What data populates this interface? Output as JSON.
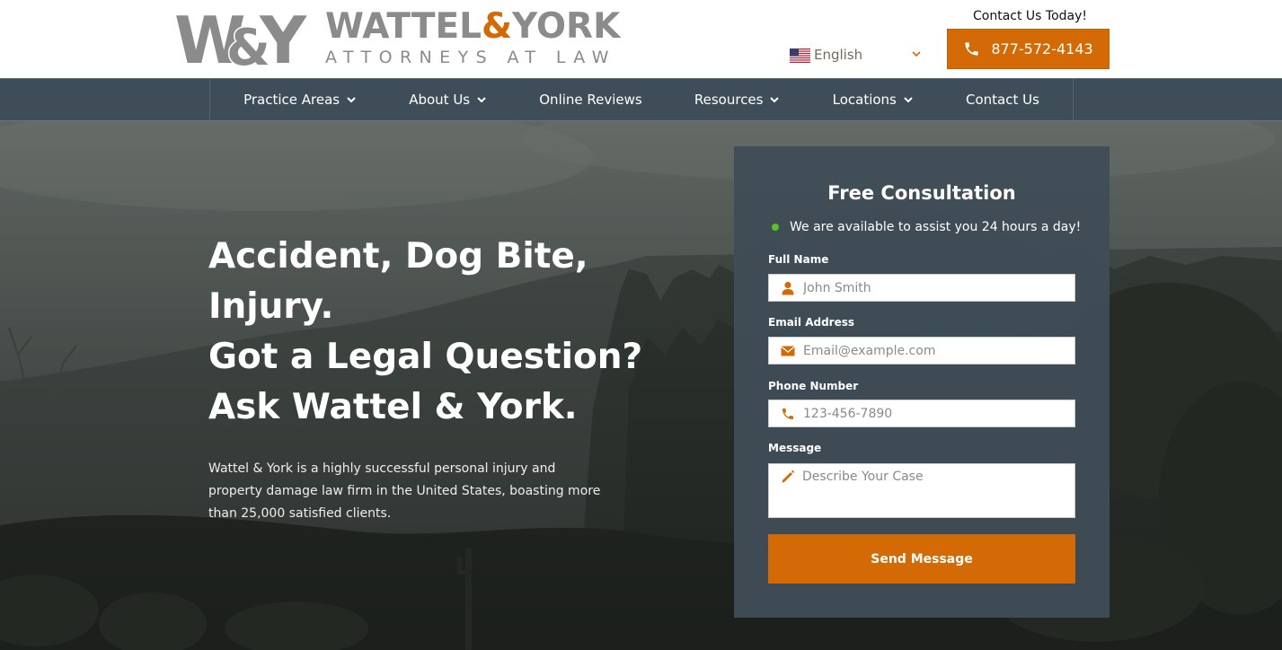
{
  "brand": {
    "name_part1": "WATTEL",
    "name_amp": "&",
    "name_part2": "YORK",
    "tagline": "ATTORNEYS AT LAW",
    "mark": "W&Y",
    "accent_color": "#d46a05",
    "logo_gray": "#8b8b8b"
  },
  "header": {
    "language": {
      "label": "English",
      "flag_icon": "us-flag-icon"
    },
    "contact_today": "Contact Us Today!",
    "phone": "877-572-4143"
  },
  "nav": {
    "items": [
      {
        "label": "Practice Areas",
        "has_dropdown": true
      },
      {
        "label": "About Us",
        "has_dropdown": true
      },
      {
        "label": "Online Reviews",
        "has_dropdown": false
      },
      {
        "label": "Resources",
        "has_dropdown": true
      },
      {
        "label": "Locations",
        "has_dropdown": true
      },
      {
        "label": "Contact Us",
        "has_dropdown": false
      }
    ],
    "background": "#3e4d57"
  },
  "hero": {
    "headline_lines": [
      "Accident, Dog Bite,",
      "Injury.",
      "Got a Legal Question?",
      "Ask Wattel & York."
    ],
    "intro": "Wattel & York is a highly successful personal injury and property damage law firm in the United States, boasting more than 25,000 satisfied clients."
  },
  "form": {
    "title": "Free Consultation",
    "availability": "We are available to assist you 24 hours a day!",
    "availability_color": "#56c41e",
    "fields": {
      "full_name": {
        "label": "Full Name",
        "placeholder": "John Smith",
        "icon": "user-icon"
      },
      "email": {
        "label": "Email Address",
        "placeholder": "Email@example.com",
        "icon": "envelope-icon"
      },
      "phone": {
        "label": "Phone Number",
        "placeholder": "123-456-7890",
        "icon": "phone-icon"
      },
      "message": {
        "label": "Message",
        "placeholder": "Describe Your Case",
        "icon": "pencil-icon"
      }
    },
    "submit_label": "Send Message"
  }
}
